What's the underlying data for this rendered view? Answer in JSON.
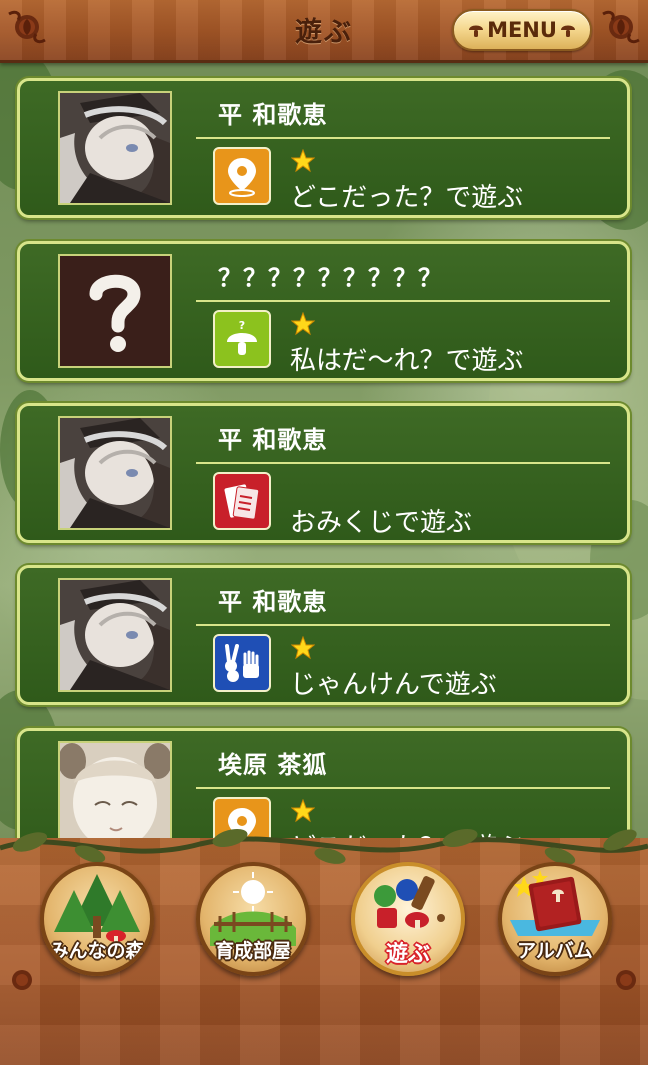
{
  "header": {
    "title": "遊ぶ",
    "menu_label": "MENU"
  },
  "cards": [
    {
      "name": "平 和歌恵",
      "portrait": "character-portrait-gray-hair",
      "game_icon": "map-pin-icon",
      "game_icon_color": "#e8951a",
      "stars": 1,
      "label": "どこだった？で遊ぶ"
    },
    {
      "name": "？？？？？？？？？",
      "portrait": "unknown-question-mark",
      "game_icon": "mushroom-question-icon",
      "game_icon_color": "#8cc21e",
      "stars": 1,
      "label": "私はだ〜れ？で遊ぶ"
    },
    {
      "name": "平 和歌恵",
      "portrait": "character-portrait-gray-hair",
      "game_icon": "omikuji-icon",
      "game_icon_color": "#c8202a",
      "stars": 0,
      "label": "おみくじで遊ぶ"
    },
    {
      "name": "平 和歌恵",
      "portrait": "character-portrait-gray-hair",
      "game_icon": "rock-paper-scissors-icon",
      "game_icon_color": "#1f4fb5",
      "stars": 1,
      "label": "じゃんけんで遊ぶ"
    },
    {
      "name": "埃原 茶狐",
      "portrait": "character-portrait-white-hair",
      "game_icon": "map-pin-icon",
      "game_icon_color": "#e8951a",
      "stars": 1,
      "label": "どこだった？で遊ぶ"
    }
  ],
  "nav": {
    "items": [
      {
        "label": "みんなの森",
        "icon": "forest-icon",
        "active": false
      },
      {
        "label": "育成部屋",
        "icon": "nursery-room-icon",
        "active": false
      },
      {
        "label": "遊ぶ",
        "icon": "play-toys-icon",
        "active": true
      },
      {
        "label": "アルバム",
        "icon": "album-book-icon",
        "active": false
      }
    ]
  },
  "colors": {
    "card_bg": "#3e6a25",
    "card_border": "#d8e58a",
    "header_wood": "#a25526",
    "active_nav_text": "#d8232a"
  }
}
